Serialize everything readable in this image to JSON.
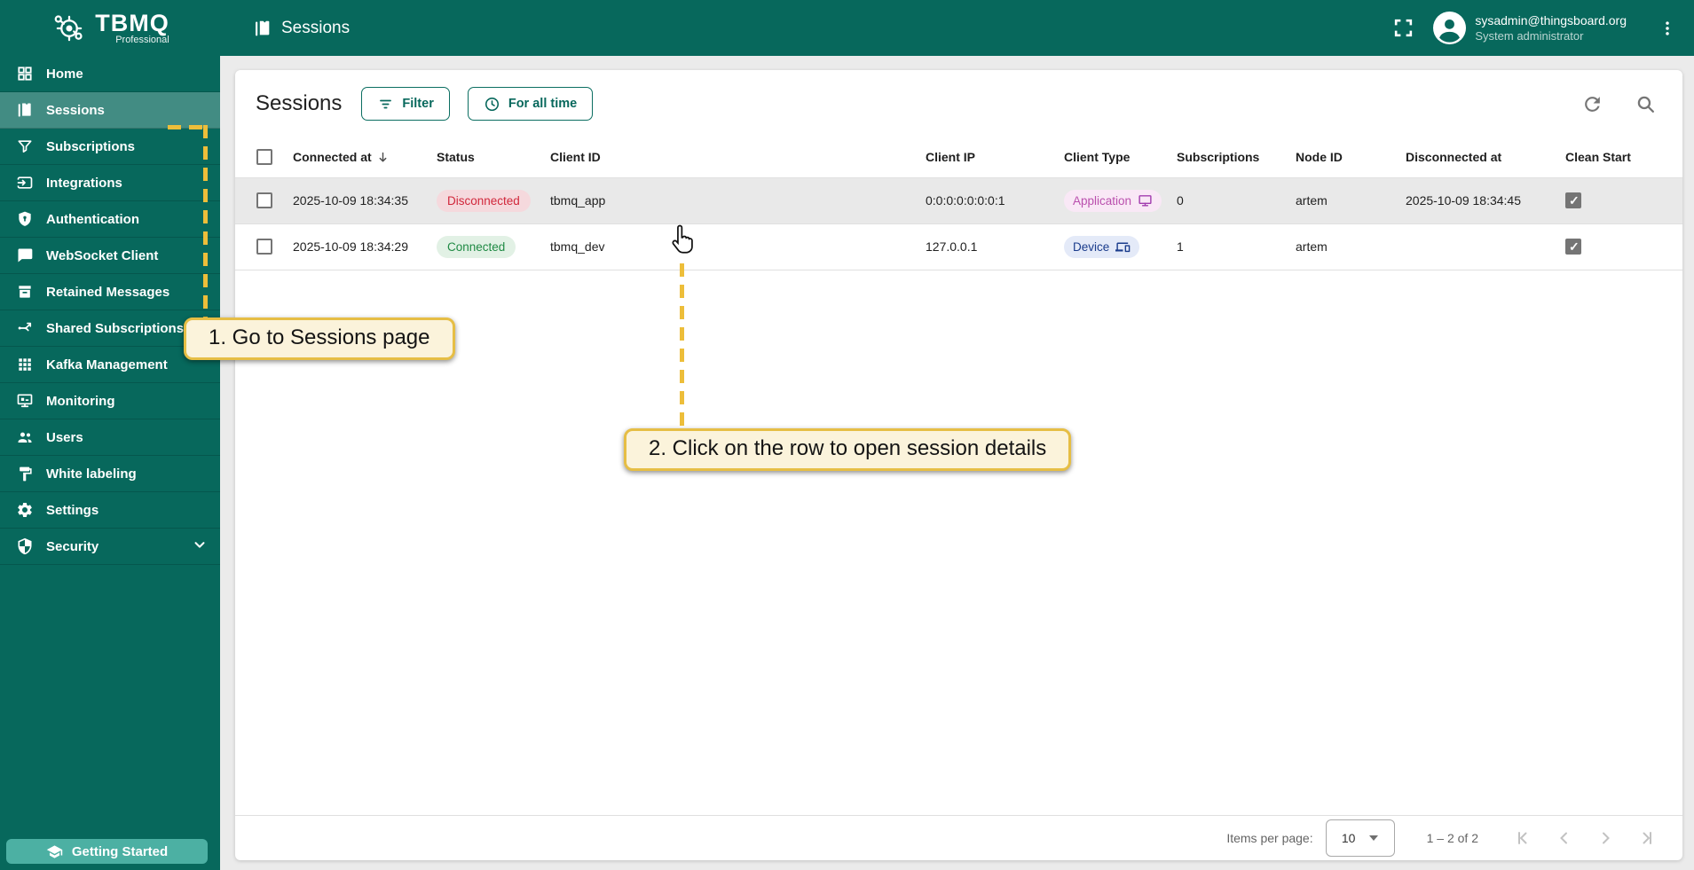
{
  "brand": {
    "name": "TBMQ",
    "subtitle": "Professional"
  },
  "topbar": {
    "title": "Sessions",
    "user_email": "sysadmin@thingsboard.org",
    "user_role": "System administrator"
  },
  "sidebar": {
    "items": [
      {
        "label": "Home",
        "icon": "dashboard-icon",
        "active": false
      },
      {
        "label": "Sessions",
        "icon": "sessions-book-icon",
        "active": true
      },
      {
        "label": "Subscriptions",
        "icon": "funnel-icon",
        "active": false
      },
      {
        "label": "Integrations",
        "icon": "input-icon",
        "active": false
      },
      {
        "label": "Authentication",
        "icon": "shield-lock-icon",
        "active": false
      },
      {
        "label": "WebSocket Client",
        "icon": "chat-bubble-icon",
        "active": false
      },
      {
        "label": "Retained Messages",
        "icon": "archive-icon",
        "active": false
      },
      {
        "label": "Shared Subscriptions",
        "icon": "call-split-icon",
        "active": false
      },
      {
        "label": "Kafka Management",
        "icon": "apps-grid-icon",
        "active": false
      },
      {
        "label": "Monitoring",
        "icon": "monitor-icon",
        "active": false
      },
      {
        "label": "Users",
        "icon": "people-icon",
        "active": false
      },
      {
        "label": "White labeling",
        "icon": "paint-roller-icon",
        "active": false
      },
      {
        "label": "Settings",
        "icon": "gear-icon",
        "active": false
      },
      {
        "label": "Security",
        "icon": "shield-half-icon",
        "active": false,
        "expandable": true
      }
    ],
    "getting_started_label": "Getting Started"
  },
  "toolbar": {
    "title": "Sessions",
    "filter_label": "Filter",
    "time_label": "For all time"
  },
  "table": {
    "columns": [
      "Connected at",
      "Status",
      "Client ID",
      "Client IP",
      "Client Type",
      "Subscriptions",
      "Node ID",
      "Disconnected at",
      "Clean Start"
    ],
    "rows": [
      {
        "connected_at": "2025-10-09 18:34:35",
        "status": "Disconnected",
        "client_id": "tbmq_app",
        "client_ip": "0:0:0:0:0:0:0:1",
        "client_type": "Application",
        "subscriptions": "0",
        "node_id": "artem",
        "disconnected_at": "2025-10-09 18:34:45",
        "clean_start": true
      },
      {
        "connected_at": "2025-10-09 18:34:29",
        "status": "Connected",
        "client_id": "tbmq_dev",
        "client_ip": "127.0.0.1",
        "client_type": "Device",
        "subscriptions": "1",
        "node_id": "artem",
        "disconnected_at": "",
        "clean_start": true
      }
    ]
  },
  "paginator": {
    "items_per_page_label": "Items per page:",
    "page_size": "10",
    "range_label": "1 – 2 of 2"
  },
  "annotations": {
    "step1": "1. Go to Sessions page",
    "step2": "2. Click on the row to open session details"
  },
  "colors": {
    "primary_teal": "#07685C",
    "active_item": "rgba(255,255,255,0.24)",
    "getting_started_bg": "#4CB0A3",
    "callout_bg": "#FBF3DB",
    "callout_border": "#E6BE45",
    "dash_line": "#EDBE3A",
    "disconnected_text": "#D1273B",
    "connected_text": "#1F8A44",
    "application_text": "#BA4FAE",
    "device_text": "#1A3C8C"
  }
}
